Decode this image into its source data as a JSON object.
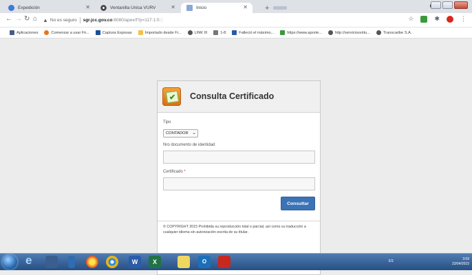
{
  "browser": {
    "tabs": [
      {
        "label": "Expedición",
        "active": false,
        "icon": "globe-icon"
      },
      {
        "label": "Ventanilla Unica VURV",
        "active": false,
        "icon": "chrome-icon"
      },
      {
        "label": "Inicio",
        "active": true,
        "icon": "grid-icon"
      }
    ],
    "new_tab": "+",
    "address": {
      "security_label": "No es seguro",
      "host": "sgr.jcc.gov.co",
      "path": ":8080/apex/f?p=117:1:0:::"
    },
    "bookmarks": [
      {
        "label": "Aplicaciones",
        "color": "#4a5a8a"
      },
      {
        "label": "Comenzar a usar Fir...",
        "color": "#e8761f"
      },
      {
        "label": "Captura Esposas",
        "color": "#1a4f9c"
      },
      {
        "label": "Importado desde Fi...",
        "color": "#f2c14a"
      },
      {
        "label": "LINK III",
        "color": "#555555"
      },
      {
        "label": "1-8",
        "color": "#777777"
      },
      {
        "label": "Falleció el máximo...",
        "color": "#2b5aa8"
      },
      {
        "label": "https://www.aporte...",
        "color": "#3a9a3a"
      },
      {
        "label": "http://serviciosvirtu...",
        "color": "#555555"
      },
      {
        "label": "Transcaribe S.A.",
        "color": "#555555"
      }
    ]
  },
  "form": {
    "title": "Consulta Certificado",
    "tipo_label": "Tipo",
    "tipo_value": "CONTADOR",
    "documento_label": "Nro documento de identidad",
    "certificado_label": "Certificado",
    "required_mark": "*",
    "submit_label": "Consultar",
    "footer_text": "© COPYRIGHT 2015 Prohibida su reproducción total o parcial, así como su traducción a cualquier idioma sin autorización escrita de su titular."
  },
  "taskbar": {
    "lang": "ES",
    "time": "3:59",
    "date": "23/04/2015"
  },
  "colors": {
    "accent_button": "#3b73b6",
    "required": "#d9261c",
    "taskbar": "#274f84"
  }
}
